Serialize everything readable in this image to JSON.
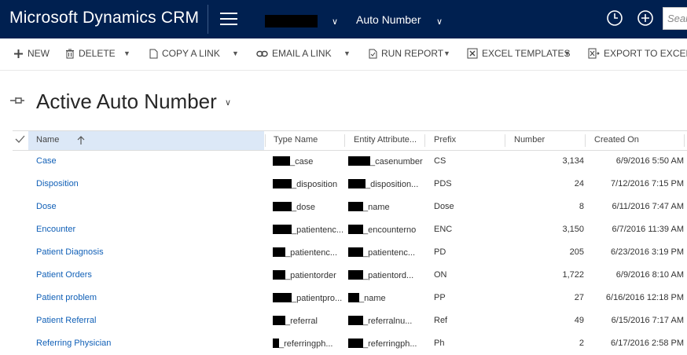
{
  "topbar": {
    "brand": "Microsoft Dynamics CRM",
    "area_label": "Auto Number",
    "search_placeholder": "Search"
  },
  "commands": {
    "new": "NEW",
    "delete": "DELETE",
    "copy_link": "COPY A LINK",
    "email_link": "EMAIL A LINK",
    "run_report": "RUN REPORT",
    "excel_templates": "EXCEL TEMPLATES",
    "export_excel": "EXPORT TO EXCEL"
  },
  "view": {
    "title": "Active Auto Number"
  },
  "grid": {
    "columns": {
      "name": "Name",
      "type_name": "Type Name",
      "entity_attribute": "Entity Attribute...",
      "prefix": "Prefix",
      "number": "Number",
      "created_on": "Created On"
    },
    "rows": [
      {
        "name": "Case",
        "type_name": "_case",
        "entity_attribute": "_casenumber",
        "prefix": "CS",
        "number": "3,134",
        "created_on": "6/9/2016 5:50 AM"
      },
      {
        "name": "Disposition",
        "type_name": "_disposition",
        "entity_attribute": "_disposition...",
        "prefix": "PDS",
        "number": "24",
        "created_on": "7/12/2016 7:15 PM"
      },
      {
        "name": "Dose",
        "type_name": "_dose",
        "entity_attribute": "_name",
        "prefix": "Dose",
        "number": "8",
        "created_on": "6/11/2016 7:47 AM"
      },
      {
        "name": "Encounter",
        "type_name": "_patientenc...",
        "entity_attribute": "_encounterno",
        "prefix": "ENC",
        "number": "3,150",
        "created_on": "6/7/2016 11:39 AM"
      },
      {
        "name": "Patient Diagnosis",
        "type_name": "_patientenc...",
        "entity_attribute": "_patientenc...",
        "prefix": "PD",
        "number": "205",
        "created_on": "6/23/2016 3:19 PM"
      },
      {
        "name": "Patient Orders",
        "type_name": "_patientorder",
        "entity_attribute": "_patientord...",
        "prefix": "ON",
        "number": "1,722",
        "created_on": "6/9/2016 8:10 AM"
      },
      {
        "name": "Patient problem",
        "type_name": "_patientpro...",
        "entity_attribute": "_name",
        "prefix": "PP",
        "number": "27",
        "created_on": "6/16/2016 12:18 PM"
      },
      {
        "name": "Patient Referral",
        "type_name": "_referral",
        "entity_attribute": "_referralnu...",
        "prefix": "Ref",
        "number": "49",
        "created_on": "6/15/2016 7:17 AM"
      },
      {
        "name": "Referring Physician",
        "type_name": "_referringph...",
        "entity_attribute": "_referringph...",
        "prefix": "Ph",
        "number": "2",
        "created_on": "6/17/2016 2:58 PM"
      }
    ]
  }
}
